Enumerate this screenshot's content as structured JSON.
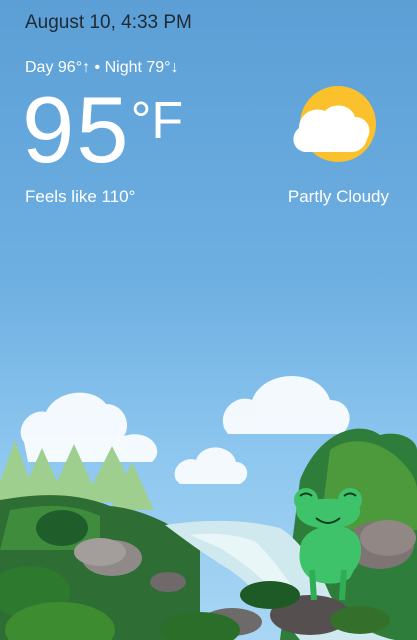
{
  "status": {
    "datetime": "August 10, 4:33 PM"
  },
  "forecast": {
    "day_night": "Day 96°↑ • Night 79°↓",
    "temp_value": "95",
    "temp_unit": "°F",
    "feels_like": "Feels like 110°",
    "condition": "Partly Cloudy",
    "condition_icon": "partly-cloudy-icon"
  },
  "illustration": {
    "name": "forest-creek-with-frog",
    "mascot": "frog"
  },
  "colors": {
    "sky_top": "#5b9fd6",
    "sky_bottom": "#a9d6f4",
    "sun": "#fbc12c",
    "frog": "#3fc36a"
  }
}
